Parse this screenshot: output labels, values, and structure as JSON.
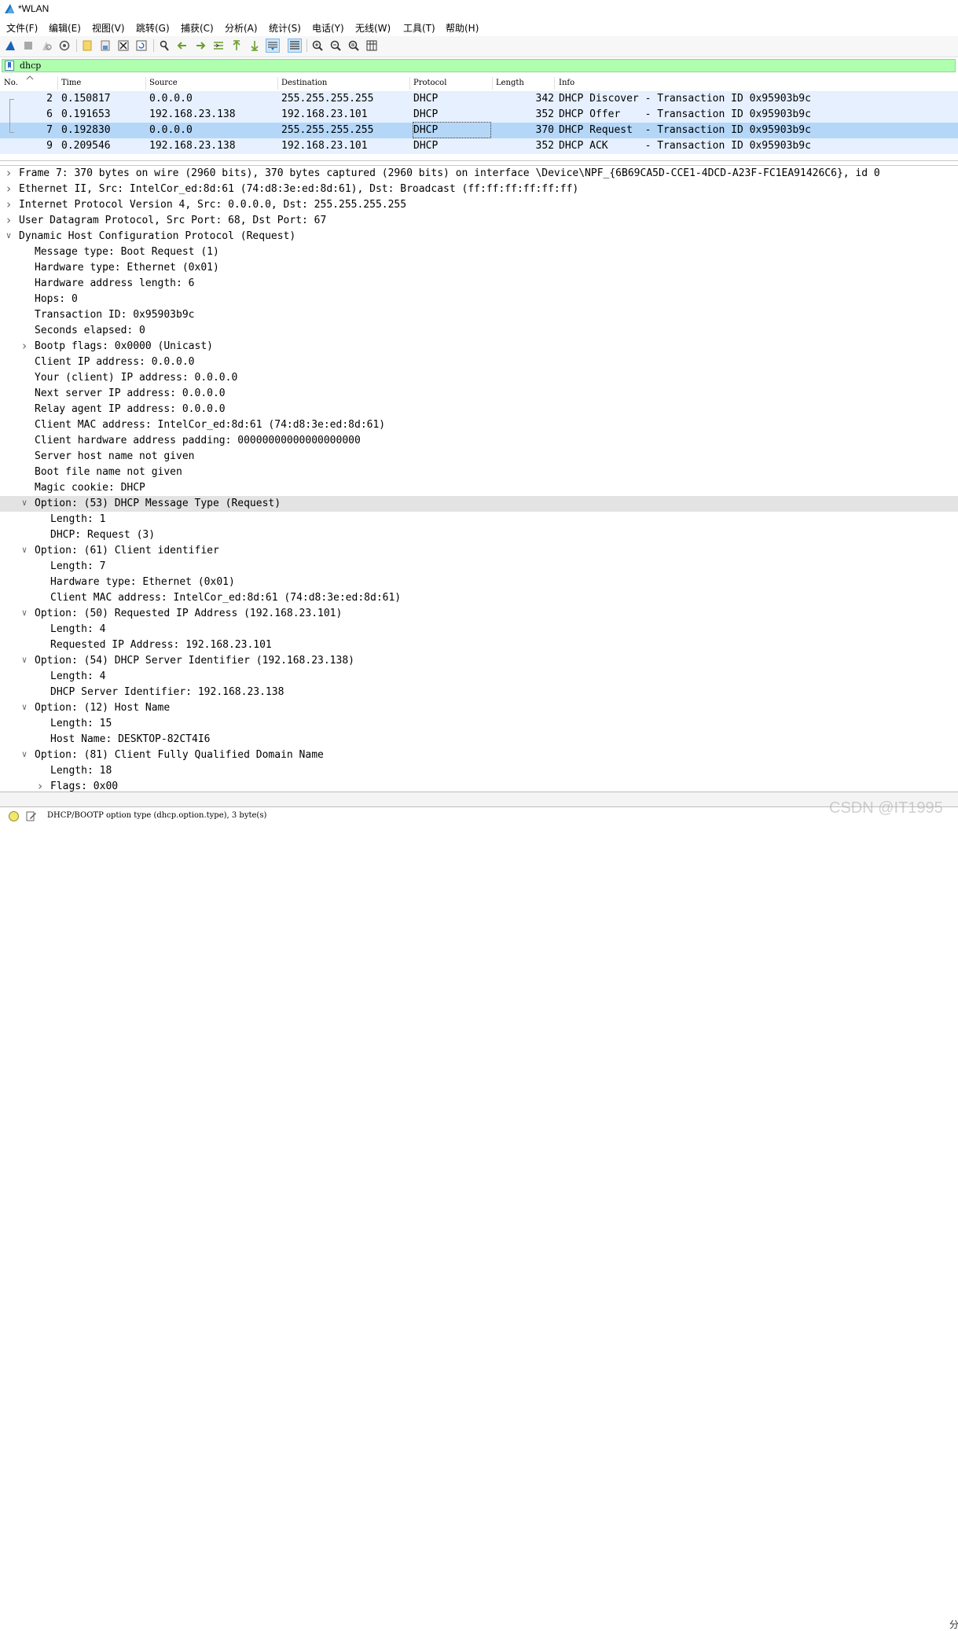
{
  "window": {
    "title": "*WLAN"
  },
  "menu": [
    "文件(F)",
    "编辑(E)",
    "视图(V)",
    "跳转(G)",
    "捕获(C)",
    "分析(A)",
    "统计(S)",
    "电话(Y)",
    "无线(W)",
    "工具(T)",
    "帮助(H)"
  ],
  "toolbar": {
    "icons": [
      "shark-fin-start-icon",
      "stop-capture-icon",
      "restart-capture-icon",
      "capture-options-icon",
      "open-file-icon",
      "save-file-icon",
      "close-file-icon",
      "reload-file-icon",
      "find-packet-icon",
      "go-back-icon",
      "go-forward-icon",
      "go-to-packet-icon",
      "go-first-icon",
      "go-last-icon",
      "autoscroll-icon",
      "colorize-icon",
      "zoom-in-icon",
      "zoom-out-icon",
      "zoom-normal-icon",
      "resize-columns-icon"
    ]
  },
  "filter": {
    "value": "dhcp",
    "color": "#afffaf"
  },
  "packet_list": {
    "columns": [
      "No.",
      "Time",
      "Source",
      "Destination",
      "Protocol",
      "Length",
      "Info"
    ],
    "rows": [
      {
        "no": "2",
        "time": "0.150817",
        "source": "0.0.0.0",
        "destination": "255.255.255.255",
        "protocol": "DHCP",
        "length": "342",
        "info": "DHCP Discover - Transaction ID 0x95903b9c",
        "selected": false
      },
      {
        "no": "6",
        "time": "0.191653",
        "source": "192.168.23.138",
        "destination": "192.168.23.101",
        "protocol": "DHCP",
        "length": "352",
        "info": "DHCP Offer    - Transaction ID 0x95903b9c",
        "selected": false
      },
      {
        "no": "7",
        "time": "0.192830",
        "source": "0.0.0.0",
        "destination": "255.255.255.255",
        "protocol": "DHCP",
        "length": "370",
        "info": "DHCP Request  - Transaction ID 0x95903b9c",
        "selected": true
      },
      {
        "no": "9",
        "time": "0.209546",
        "source": "192.168.23.138",
        "destination": "192.168.23.101",
        "protocol": "DHCP",
        "length": "352",
        "info": "DHCP ACK      - Transaction ID 0x95903b9c",
        "selected": false
      }
    ]
  },
  "details": [
    {
      "level": 0,
      "arrow": "right",
      "text": "Frame 7: 370 bytes on wire (2960 bits), 370 bytes captured (2960 bits) on interface \\Device\\NPF_{6B69CA5D-CCE1-4DCD-A23F-FC1EA91426C6}, id 0"
    },
    {
      "level": 0,
      "arrow": "right",
      "text": "Ethernet II, Src: IntelCor_ed:8d:61 (74:d8:3e:ed:8d:61), Dst: Broadcast (ff:ff:ff:ff:ff:ff)"
    },
    {
      "level": 0,
      "arrow": "right",
      "text": "Internet Protocol Version 4, Src: 0.0.0.0, Dst: 255.255.255.255"
    },
    {
      "level": 0,
      "arrow": "right",
      "text": "User Datagram Protocol, Src Port: 68, Dst Port: 67"
    },
    {
      "level": 0,
      "arrow": "down",
      "text": "Dynamic Host Configuration Protocol (Request)"
    },
    {
      "level": 1,
      "arrow": "",
      "text": "Message type: Boot Request (1)"
    },
    {
      "level": 1,
      "arrow": "",
      "text": "Hardware type: Ethernet (0x01)"
    },
    {
      "level": 1,
      "arrow": "",
      "text": "Hardware address length: 6"
    },
    {
      "level": 1,
      "arrow": "",
      "text": "Hops: 0"
    },
    {
      "level": 1,
      "arrow": "",
      "text": "Transaction ID: 0x95903b9c"
    },
    {
      "level": 1,
      "arrow": "",
      "text": "Seconds elapsed: 0"
    },
    {
      "level": 1,
      "arrow": "right",
      "text": "Bootp flags: 0x0000 (Unicast)"
    },
    {
      "level": 1,
      "arrow": "",
      "text": "Client IP address: 0.0.0.0"
    },
    {
      "level": 1,
      "arrow": "",
      "text": "Your (client) IP address: 0.0.0.0"
    },
    {
      "level": 1,
      "arrow": "",
      "text": "Next server IP address: 0.0.0.0"
    },
    {
      "level": 1,
      "arrow": "",
      "text": "Relay agent IP address: 0.0.0.0"
    },
    {
      "level": 1,
      "arrow": "",
      "text": "Client MAC address: IntelCor_ed:8d:61 (74:d8:3e:ed:8d:61)"
    },
    {
      "level": 1,
      "arrow": "",
      "text": "Client hardware address padding: 00000000000000000000"
    },
    {
      "level": 1,
      "arrow": "",
      "text": "Server host name not given"
    },
    {
      "level": 1,
      "arrow": "",
      "text": "Boot file name not given"
    },
    {
      "level": 1,
      "arrow": "",
      "text": "Magic cookie: DHCP"
    },
    {
      "level": 1,
      "arrow": "down",
      "text": "Option: (53) DHCP Message Type (Request)",
      "highlighted": true
    },
    {
      "level": 2,
      "arrow": "",
      "text": "Length: 1"
    },
    {
      "level": 2,
      "arrow": "",
      "text": "DHCP: Request (3)"
    },
    {
      "level": 1,
      "arrow": "down",
      "text": "Option: (61) Client identifier"
    },
    {
      "level": 2,
      "arrow": "",
      "text": "Length: 7"
    },
    {
      "level": 2,
      "arrow": "",
      "text": "Hardware type: Ethernet (0x01)"
    },
    {
      "level": 2,
      "arrow": "",
      "text": "Client MAC address: IntelCor_ed:8d:61 (74:d8:3e:ed:8d:61)"
    },
    {
      "level": 1,
      "arrow": "down",
      "text": "Option: (50) Requested IP Address (192.168.23.101)"
    },
    {
      "level": 2,
      "arrow": "",
      "text": "Length: 4"
    },
    {
      "level": 2,
      "arrow": "",
      "text": "Requested IP Address: 192.168.23.101"
    },
    {
      "level": 1,
      "arrow": "down",
      "text": "Option: (54) DHCP Server Identifier (192.168.23.138)"
    },
    {
      "level": 2,
      "arrow": "",
      "text": "Length: 4"
    },
    {
      "level": 2,
      "arrow": "",
      "text": "DHCP Server Identifier: 192.168.23.138"
    },
    {
      "level": 1,
      "arrow": "down",
      "text": "Option: (12) Host Name"
    },
    {
      "level": 2,
      "arrow": "",
      "text": "Length: 15"
    },
    {
      "level": 2,
      "arrow": "",
      "text": "Host Name: DESKTOP-82CT4I6"
    },
    {
      "level": 1,
      "arrow": "down",
      "text": "Option: (81) Client Fully Qualified Domain Name"
    },
    {
      "level": 2,
      "arrow": "",
      "text": "Length: 18"
    },
    {
      "level": 2,
      "arrow": "right",
      "text": "Flags: 0x00"
    }
  ],
  "status": {
    "text": "DHCP/BOOTP option type (dhcp.option.type), 3 byte(s)",
    "right_char": "分"
  },
  "watermark": "CSDN @IT1995"
}
